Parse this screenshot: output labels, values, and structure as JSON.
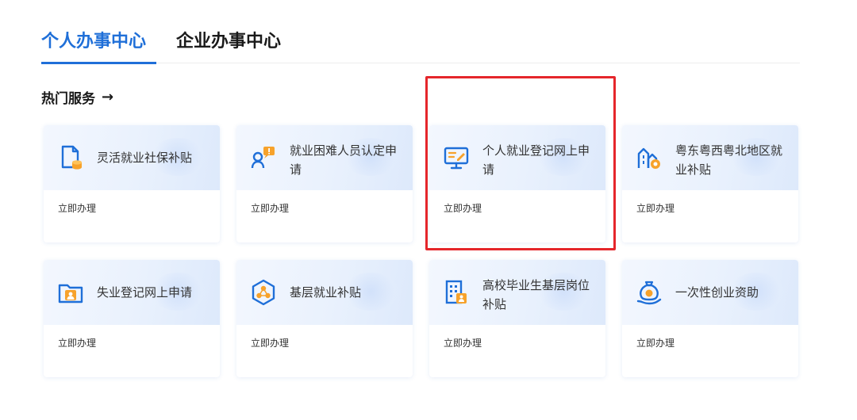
{
  "tabs": [
    {
      "label": "个人办事中心",
      "active": true
    },
    {
      "label": "企业办事中心",
      "active": false
    }
  ],
  "section": {
    "title": "热门服务",
    "arrow": "→"
  },
  "colors": {
    "accent": "#1f6fd8",
    "icon_orange": "#f7a22b",
    "highlight": "#e5262b"
  },
  "cards": [
    {
      "title": "灵活就业社保补贴",
      "action": "立即办理",
      "icon": "document-coins-icon"
    },
    {
      "title": "就业困难人员认定申请",
      "action": "立即办理",
      "icon": "person-alert-icon"
    },
    {
      "title": "个人就业登记网上申请",
      "action": "立即办理",
      "icon": "monitor-edit-icon",
      "highlighted": true
    },
    {
      "title": "粤东粤西粤北地区就业补贴",
      "action": "立即办理",
      "icon": "buildings-coin-icon"
    },
    {
      "title": "失业登记网上申请",
      "action": "立即办理",
      "icon": "folder-person-icon"
    },
    {
      "title": "基层就业补贴",
      "action": "立即办理",
      "icon": "hexagon-network-icon"
    },
    {
      "title": "高校毕业生基层岗位补贴",
      "action": "立即办理",
      "icon": "building-grid-icon"
    },
    {
      "title": "一次性创业资助",
      "action": "立即办理",
      "icon": "moneybag-hand-icon"
    }
  ]
}
